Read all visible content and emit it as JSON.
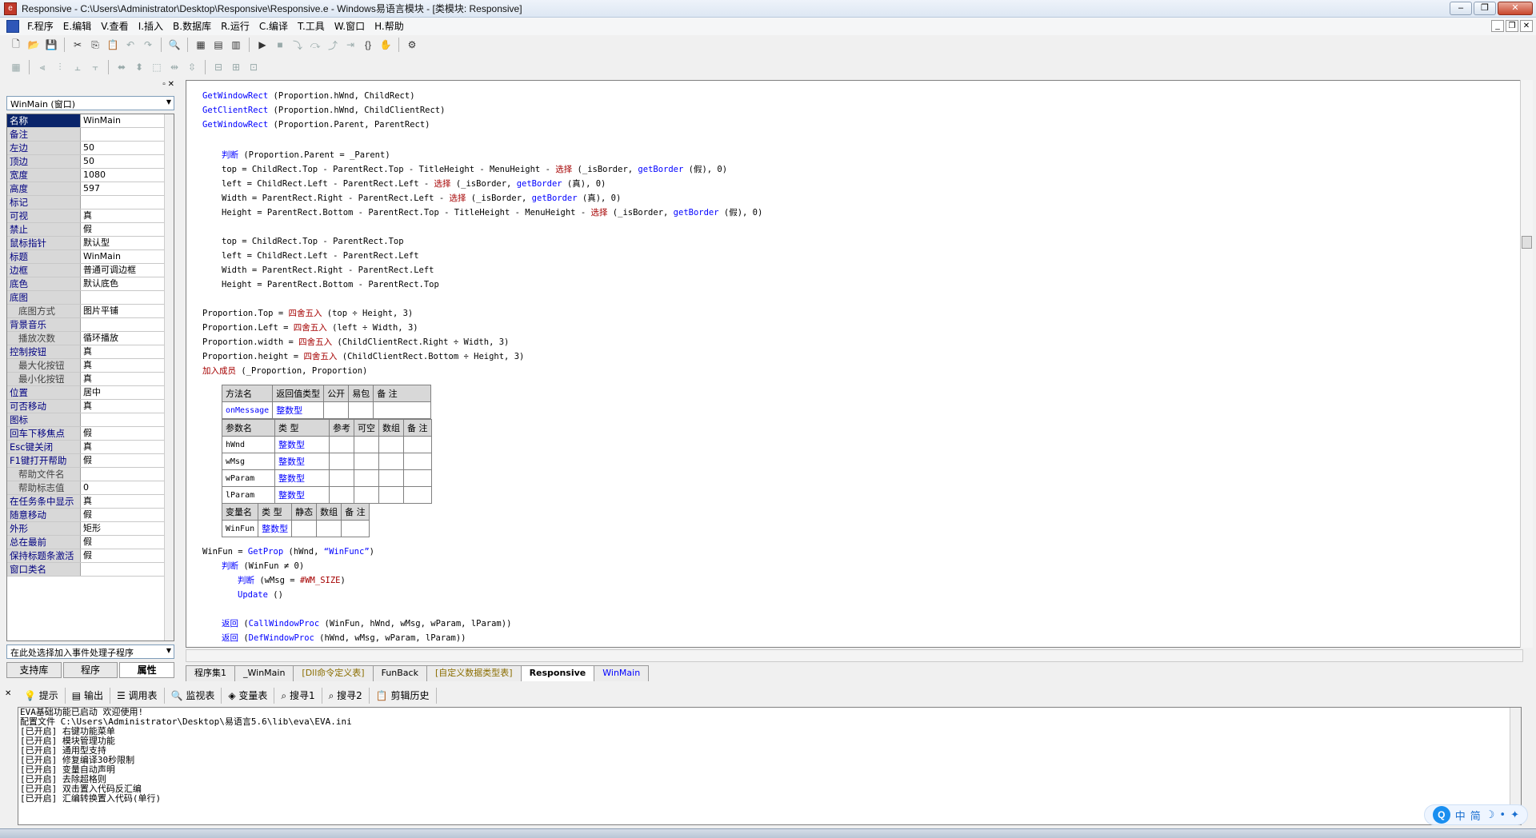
{
  "window": {
    "title": "Responsive - C:\\Users\\Administrator\\Desktop\\Responsive\\Responsive.e - Windows易语言模块 - [类模块: Responsive]"
  },
  "menu": [
    "F.程序",
    "E.编辑",
    "V.查看",
    "I.插入",
    "B.数据库",
    "R.运行",
    "C.编译",
    "T.工具",
    "W.窗口",
    "H.帮助"
  ],
  "left": {
    "object_selector": "WinMain (窗口)",
    "event_selector": "在此处选择加入事件处理子程序",
    "tabs": [
      "支持库",
      "程序",
      "属性"
    ],
    "props": [
      {
        "name": "名称",
        "value": "WinMain"
      },
      {
        "name": "备注",
        "value": ""
      },
      {
        "name": "左边",
        "value": "50"
      },
      {
        "name": "顶边",
        "value": "50"
      },
      {
        "name": "宽度",
        "value": "1080"
      },
      {
        "name": "高度",
        "value": "597"
      },
      {
        "name": "标记",
        "value": ""
      },
      {
        "name": "可视",
        "value": "真"
      },
      {
        "name": "禁止",
        "value": "假"
      },
      {
        "name": "鼠标指针",
        "value": "默认型"
      },
      {
        "name": "标题",
        "value": "WinMain"
      },
      {
        "name": "边框",
        "value": "普通可调边框"
      },
      {
        "name": "底色",
        "value": "默认底色"
      },
      {
        "name": "底图",
        "value": ""
      },
      {
        "name": "底图方式",
        "value": "图片平铺",
        "sub": true
      },
      {
        "name": "背景音乐",
        "value": ""
      },
      {
        "name": "播放次数",
        "value": "循环播放",
        "sub": true
      },
      {
        "name": "控制按钮",
        "value": "真"
      },
      {
        "name": "最大化按钮",
        "value": "真",
        "sub": true
      },
      {
        "name": "最小化按钮",
        "value": "真",
        "sub": true
      },
      {
        "name": "位置",
        "value": "居中"
      },
      {
        "name": "可否移动",
        "value": "真"
      },
      {
        "name": "图标",
        "value": ""
      },
      {
        "name": "回车下移焦点",
        "value": "假"
      },
      {
        "name": "Esc键关闭",
        "value": "真"
      },
      {
        "name": "F1键打开帮助",
        "value": "假"
      },
      {
        "name": "帮助文件名",
        "value": "",
        "sub": true
      },
      {
        "name": "帮助标志值",
        "value": "0",
        "sub": true
      },
      {
        "name": "在任务条中显示",
        "value": "真"
      },
      {
        "name": "随意移动",
        "value": "假"
      },
      {
        "name": "外形",
        "value": "矩形"
      },
      {
        "name": "总在最前",
        "value": "假"
      },
      {
        "name": "保持标题条激活",
        "value": "假"
      },
      {
        "name": "窗口类名",
        "value": ""
      }
    ]
  },
  "code_lines": [
    {
      "t": "GetWindowRect (Proportion.hWnd, ChildRect)"
    },
    {
      "t": "GetClientRect (Proportion.hWnd, ChildClientRect)"
    },
    {
      "t": "GetWindowRect (Proportion.Parent, ParentRect)"
    },
    {
      "t": "判断 (Proportion.Parent = _Parent)"
    },
    {
      "t": "top = ChildRect.Top - ParentRect.Top - TitleHeight - MenuHeight - 选择 (_isBorder, getBorder (假), 0)"
    },
    {
      "t": "left = ChildRect.Left - ParentRect.Left - 选择 (_isBorder, getBorder (真), 0)"
    },
    {
      "t": "Width = ParentRect.Right - ParentRect.Left - 选择 (_isBorder, getBorder (真), 0)"
    },
    {
      "t": "Height = ParentRect.Bottom - ParentRect.Top - TitleHeight - MenuHeight - 选择 (_isBorder, getBorder (假), 0)"
    },
    {
      "t": "top = ChildRect.Top - ParentRect.Top"
    },
    {
      "t": "left = ChildRect.Left - ParentRect.Left"
    },
    {
      "t": "Width = ParentRect.Right - ParentRect.Left"
    },
    {
      "t": "Height = ParentRect.Bottom - ParentRect.Top"
    },
    {
      "t": "Proportion.Top = 四舍五入 (top ÷ Height, 3)"
    },
    {
      "t": "Proportion.Left = 四舍五入 (left ÷ Width, 3)"
    },
    {
      "t": "Proportion.width = 四舍五入 (ChildClientRect.Right ÷ Width, 3)"
    },
    {
      "t": "Proportion.height = 四舍五入 (ChildClientRect.Bottom ÷ Height, 3)"
    },
    {
      "t": "加入成员 (_Proportion, Proportion)"
    },
    {
      "t": "WinFun = GetProp (hWnd, “WinFunc”)"
    },
    {
      "t": "判断 (WinFun ≠ 0)"
    },
    {
      "t": "判断 (wMsg = #WM_SIZE)"
    },
    {
      "t": "Update ()"
    },
    {
      "t": "返回 (CallWindowProc (WinFun, hWnd, wMsg, wParam, lParam))"
    },
    {
      "t": "返回 (DefWindowProc (hWnd, wMsg, wParam, lParam))"
    }
  ],
  "method_table": {
    "headers": [
      "方法名",
      "返回值类型",
      "公开",
      "易包",
      "备 注"
    ],
    "row": [
      "onMessage",
      "整数型",
      "",
      "",
      ""
    ],
    "param_headers": [
      "参数名",
      "类 型",
      "参考",
      "可空",
      "数组",
      "备 注"
    ],
    "params": [
      [
        "hWnd",
        "整数型",
        "",
        "",
        "",
        ""
      ],
      [
        "wMsg",
        "整数型",
        "",
        "",
        "",
        ""
      ],
      [
        "wParam",
        "整数型",
        "",
        "",
        "",
        ""
      ],
      [
        "lParam",
        "整数型",
        "",
        "",
        "",
        ""
      ]
    ]
  },
  "var_table": {
    "headers": [
      "变量名",
      "类 型",
      "静态",
      "数组",
      "备 注"
    ],
    "row": [
      "WinFun",
      "整数型",
      "",
      "",
      ""
    ]
  },
  "doc_tabs": [
    "程序集1",
    "_WinMain",
    "[Dll命令定义表]",
    "FunBack",
    "[自定义数据类型表]",
    "Responsive",
    "WinMain"
  ],
  "bottom_tabs": [
    "提示",
    "输出",
    "调用表",
    "监视表",
    "变量表",
    "搜寻1",
    "搜寻2",
    "剪辑历史"
  ],
  "output_lines": [
    "EVA基础功能已启动 欢迎使用!",
    "配置文件 C:\\Users\\Administrator\\Desktop\\易语言5.6\\lib\\eva\\EVA.ini",
    "[已开启] 右键功能菜单",
    "[已开启] 模块管理功能",
    "[已开启] 通用型支持",
    "[已开启] 修复编译30秒限制",
    "[已开启] 变量自动声明",
    "[已开启] 去除超格则",
    "[已开启] 双击置入代码反汇编",
    "[已开启] 汇编转换置入代码(单行)"
  ],
  "ime": {
    "label1": "中",
    "label2": "简"
  }
}
